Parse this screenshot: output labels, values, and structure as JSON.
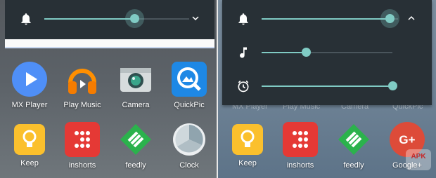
{
  "left": {
    "volume_sheet": {
      "rows": [
        {
          "icon": "bell-icon",
          "level": 0.62
        }
      ],
      "toggle_icon": "chevron-down-icon"
    },
    "apps": [
      {
        "label": "MX Player",
        "icon": "play-icon",
        "color": "#4f8ff7"
      },
      {
        "label": "Play Music",
        "icon": "headphones-icon",
        "color": "#f57c00"
      },
      {
        "label": "Camera",
        "icon": "camera-icon",
        "color": "#d7dcdd"
      },
      {
        "label": "QuickPic",
        "icon": "quickpic-icon",
        "color": "#1e88e5"
      },
      {
        "label": "Keep",
        "icon": "lightbulb-icon",
        "color": "#fbc02d"
      },
      {
        "label": "inshorts",
        "icon": "inshorts-icon",
        "color": "#e53935"
      },
      {
        "label": "feedly",
        "icon": "feedly-icon",
        "color": "#2bb24c"
      },
      {
        "label": "Clock",
        "icon": "clock-icon",
        "color": "#b0bec5"
      }
    ]
  },
  "right": {
    "volume_sheet": {
      "rows": [
        {
          "icon": "bell-icon",
          "level": 0.94
        },
        {
          "icon": "music-note-icon",
          "level": 0.34
        },
        {
          "icon": "alarm-icon",
          "level": 1.0
        }
      ],
      "toggle_icon": "chevron-up-icon"
    },
    "hidden_labels": [
      "MX Player",
      "Play Music",
      "Camera",
      "QuickPic"
    ],
    "apps": [
      {
        "label": "Keep",
        "icon": "lightbulb-icon",
        "color": "#fbc02d"
      },
      {
        "label": "inshorts",
        "icon": "inshorts-icon",
        "color": "#e53935"
      },
      {
        "label": "feedly",
        "icon": "feedly-icon",
        "color": "#2bb24c"
      },
      {
        "label": "Google+",
        "icon": "google-plus-icon",
        "color": "#dd4b39"
      }
    ]
  },
  "watermark": {
    "text": "APK"
  },
  "colors": {
    "accent": "#80cbc4",
    "sheet": "#283036"
  }
}
